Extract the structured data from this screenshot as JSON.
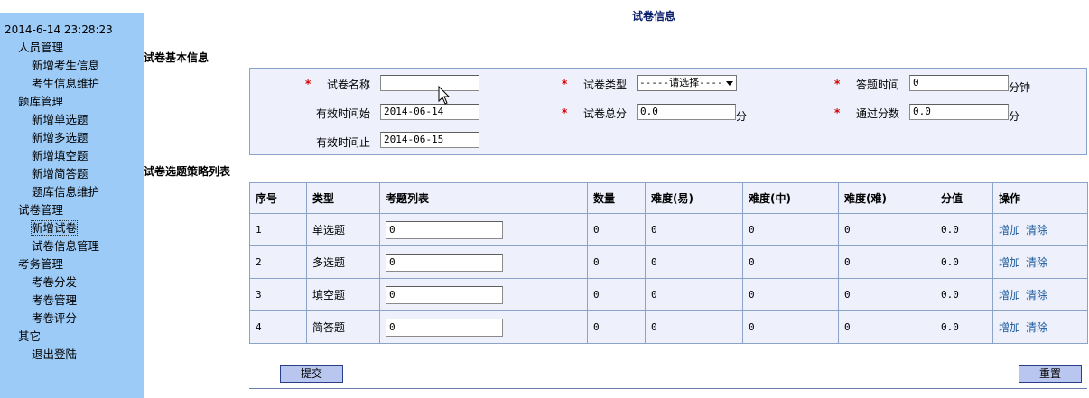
{
  "sidebar": {
    "clock": "2014-6-14 23:28:23",
    "items": [
      {
        "label": "人员管理",
        "level": 0
      },
      {
        "label": "新增考生信息",
        "level": 1
      },
      {
        "label": "考生信息维护",
        "level": 1
      },
      {
        "label": "题库管理",
        "level": 0
      },
      {
        "label": "新增单选题",
        "level": 1
      },
      {
        "label": "新增多选题",
        "level": 1
      },
      {
        "label": "新增填空题",
        "level": 1
      },
      {
        "label": "新增简答题",
        "level": 1
      },
      {
        "label": "题库信息维护",
        "level": 1
      },
      {
        "label": "试卷管理",
        "level": 0
      },
      {
        "label": "新增试卷",
        "level": 1,
        "active": true
      },
      {
        "label": "试卷信息管理",
        "level": 1
      },
      {
        "label": "考务管理",
        "level": 0
      },
      {
        "label": "考卷分发",
        "level": 1
      },
      {
        "label": "考卷管理",
        "level": 1
      },
      {
        "label": "考卷评分",
        "level": 1
      },
      {
        "label": "其它",
        "level": 0
      },
      {
        "label": "退出登陆",
        "level": 1
      }
    ]
  },
  "page_title": "试卷信息",
  "basic": {
    "section_title": "试卷基本信息",
    "required_mark": "*",
    "name_label": "试卷名称",
    "name_value": "",
    "type_label": "试卷类型",
    "type_value": "-----请选择----",
    "duration_label": "答题时间",
    "duration_value": "0",
    "duration_unit": "分钟",
    "start_label": "有效时间始",
    "start_value": "2014-06-14",
    "total_label": "试卷总分",
    "total_value": "0.0",
    "total_unit": "分",
    "pass_label": "通过分数",
    "pass_value": "0.0",
    "pass_unit": "分",
    "end_label": "有效时间止",
    "end_value": "2014-06-15"
  },
  "strategy": {
    "section_title": "试卷选题策略列表",
    "headers": [
      "序号",
      "类型",
      "考题列表",
      "数量",
      "难度(易)",
      "难度(中)",
      "难度(难)",
      "分值",
      "操作"
    ],
    "rows": [
      {
        "no": "1",
        "type": "单选题",
        "list": "0",
        "count": "0",
        "easy": "0",
        "mid": "0",
        "hard": "0",
        "score": "0.0"
      },
      {
        "no": "2",
        "type": "多选题",
        "list": "0",
        "count": "0",
        "easy": "0",
        "mid": "0",
        "hard": "0",
        "score": "0.0"
      },
      {
        "no": "3",
        "type": "填空题",
        "list": "0",
        "count": "0",
        "easy": "0",
        "mid": "0",
        "hard": "0",
        "score": "0.0"
      },
      {
        "no": "4",
        "type": "简答题",
        "list": "0",
        "count": "0",
        "easy": "0",
        "mid": "0",
        "hard": "0",
        "score": "0.0"
      }
    ],
    "add_label": "增加",
    "clear_label": "清除"
  },
  "buttons": {
    "submit": "提交",
    "reset": "重置"
  },
  "colors": {
    "sidebar_bg": "#9dcbf7",
    "panel_bg": "#eef0fb",
    "border": "#8aa3c6",
    "required": "#d40000",
    "link": "#1a5a9e",
    "button_bg": "#b9c7f0"
  }
}
